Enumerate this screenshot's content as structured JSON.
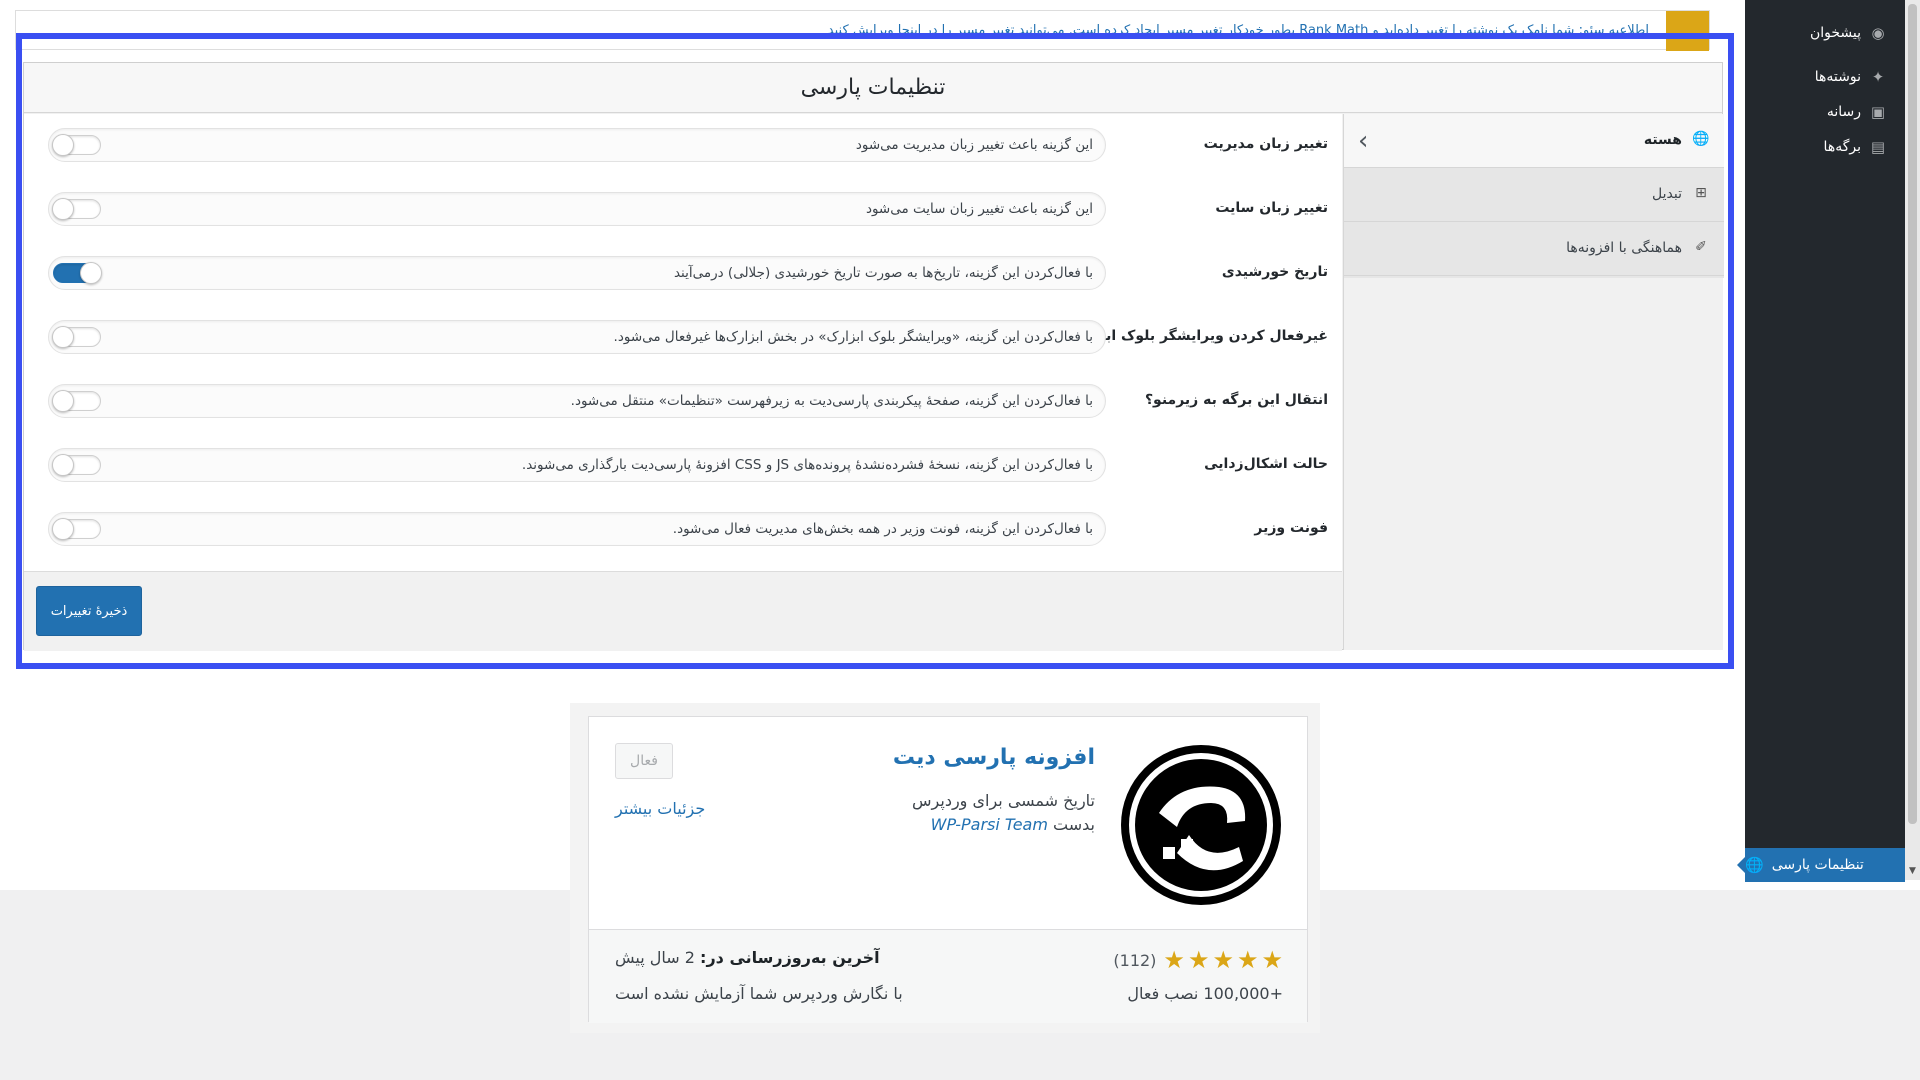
{
  "sidebar": {
    "items": [
      {
        "label": "پیشخوان",
        "icon": "dashboard-icon"
      },
      {
        "label": "نوشته‌ها",
        "icon": "pin-icon"
      },
      {
        "label": "رسانه",
        "icon": "media-icon"
      },
      {
        "label": "برگه‌ها",
        "icon": "pages-icon"
      }
    ],
    "active_item": {
      "label": "تنظیمات پارسی",
      "icon": "globe-icon"
    }
  },
  "notice": {
    "text": "اطلاعیه سئو: شما نامک یک نوشته را تغییر داده‌اید و Rank Math بطور خودکار تغییر مسیر ایجاد کرده است. می‌توانید تغییر مسیر را در اینجا ویرایش کنید"
  },
  "settings": {
    "title": "تنظیمات پارسی",
    "rows": [
      {
        "label": "تغییر زبان مدیریت",
        "description": "این گزینه باعث تغییر زبان مدیریت می‌شود",
        "enabled": false
      },
      {
        "label": "تغییر زبان سایت",
        "description": "این گزینه باعث تغییر زبان سایت می‌شود",
        "enabled": false
      },
      {
        "label": "تاریخ خورشیدی",
        "description": "با فعال‌کردن این گزینه، تاریخ‌ها به صورت تاریخ خورشیدی (جلالی) درمی‌آیند",
        "enabled": true
      },
      {
        "label": "غیرفعال کردن ویرایشگر بلوک ابزارک",
        "description": "با فعال‌کردن این گزینه، «ویرایشگر بلوک ابزارک» در بخش ابزارک‌ها غیرفعال می‌شود.",
        "enabled": false
      },
      {
        "label": "انتقال این برگه به زیرمنو؟",
        "description": "با فعال‌کردن این گزینه، صفحهٔ پیکربندی پارسی‌دیت به زیرفهرست «تنظیمات» منتقل می‌شود.",
        "enabled": false
      },
      {
        "label": "حالت اشکال‌زدایی",
        "description": "با فعال‌کردن این گزینه، نسخهٔ فشرده‌نشدهٔ پرونده‌های JS و CSS افزونهٔ پارسی‌دیت بارگذاری می‌شوند.",
        "enabled": false
      },
      {
        "label": "فونت وزیر",
        "description": "با فعال‌کردن این گزینه، فونت وزیر در همه بخش‌های مدیریت فعال می‌شود.",
        "enabled": false
      }
    ],
    "save_label": "ذخیرهٔ تغییرات",
    "tabs": [
      {
        "label": "هسته",
        "icon": "globe-icon"
      },
      {
        "label": "تبدیل",
        "icon": "grid-icon"
      },
      {
        "label": "هماهنگی با افزونه‌ها",
        "icon": "plugin-icon"
      }
    ]
  },
  "plugin_card": {
    "name": "افزونه پارسی دیت",
    "description": "تاریخ شمسی برای وردپرس",
    "author_prefix": "بدست",
    "author": "WP-Parsi Team",
    "status_button": "فعال",
    "details_link": "جزئیات بیشتر",
    "rating_count": "(112)",
    "rating_stars": 5,
    "installs": "+100,000 نصب فعال",
    "updated_label": "آخرین به‌روزرسانی در:",
    "updated_value": "2 سال پیش",
    "compatibility": "با نگارش وردپرس شما آزمایش نشده است"
  },
  "colors": {
    "accent": "#2271b1",
    "sidebar": "#23282d",
    "highlight_frame": "#3a4ff2",
    "notice_bar": "#dba617",
    "stars": "#dba617"
  }
}
